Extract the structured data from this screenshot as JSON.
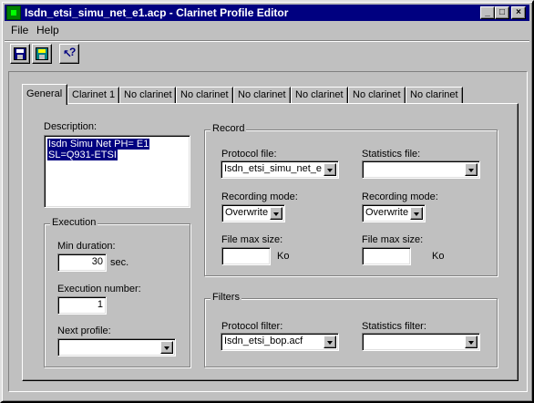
{
  "window": {
    "title": "Isdn_etsi_simu_net_e1.acp - Clarinet Profile Editor"
  },
  "titlebar_buttons": {
    "minimize": "_",
    "maximize": "□",
    "close": "×"
  },
  "menu": {
    "file": "File",
    "help": "Help"
  },
  "toolbar": {
    "icons": [
      "save-icon",
      "save-as-icon",
      "context-help-icon"
    ]
  },
  "tabs": [
    {
      "label": "General",
      "active": true
    },
    {
      "label": "Clarinet 1"
    },
    {
      "label": "No clarinet"
    },
    {
      "label": "No clarinet"
    },
    {
      "label": "No clarinet"
    },
    {
      "label": "No clarinet"
    },
    {
      "label": "No clarinet"
    },
    {
      "label": "No clarinet"
    }
  ],
  "description": {
    "label": "Description:",
    "lines": [
      "Isdn Simu Net PH= E1",
      "SL=Q931-ETSI"
    ]
  },
  "execution": {
    "title": "Execution",
    "min_duration_label": "Min duration:",
    "min_duration_value": "30",
    "min_duration_unit": "sec.",
    "execution_number_label": "Execution number:",
    "execution_number_value": "1",
    "next_profile_label": "Next profile:",
    "next_profile_value": ""
  },
  "record": {
    "title": "Record",
    "protocol_file_label": "Protocol file:",
    "protocol_file_value": "Isdn_etsi_simu_net_e",
    "statistics_file_label": "Statistics file:",
    "statistics_file_value": "",
    "recording_mode_label_1": "Recording mode:",
    "recording_mode_value_1": "Overwrite",
    "recording_mode_label_2": "Recording mode:",
    "recording_mode_value_2": "Overwrite",
    "file_max_size_label_1": "File max size:",
    "file_max_size_value_1": "",
    "file_max_size_unit_1": "Ko",
    "file_max_size_label_2": "File max size:",
    "file_max_size_value_2": "",
    "file_max_size_unit_2": "Ko"
  },
  "filters": {
    "title": "Filters",
    "protocol_filter_label": "Protocol filter:",
    "protocol_filter_value": "Isdn_etsi_bop.acf",
    "statistics_filter_label": "Statistics filter:",
    "statistics_filter_value": ""
  }
}
